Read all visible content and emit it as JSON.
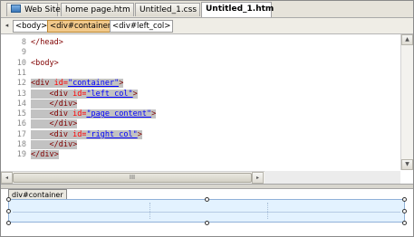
{
  "tabs": [
    {
      "label": "Web Site",
      "icon": "web-site-icon",
      "active": false
    },
    {
      "label": "home page.htm",
      "active": false
    },
    {
      "label": "Untitled_1.css",
      "active": false
    },
    {
      "label": "Untitled_1.htm",
      "active": true
    }
  ],
  "tag_selector": {
    "back_glyph": "◂",
    "forward_glyph": "▸",
    "crumbs": [
      "<body>",
      "<div#container>",
      "<div#left_col>"
    ],
    "selected_index": 1,
    "selected_color": "#f2c98a"
  },
  "code": {
    "lines": [
      {
        "num": "8",
        "parts": [
          {
            "t": "</head>",
            "c": "tag"
          }
        ],
        "indent": "",
        "highlight": false
      },
      {
        "num": "9",
        "parts": [],
        "indent": "",
        "highlight": false
      },
      {
        "num": "10",
        "parts": [
          {
            "t": "<body>",
            "c": "tag"
          }
        ],
        "indent": "",
        "highlight": false
      },
      {
        "num": "11",
        "parts": [],
        "indent": "",
        "highlight": false
      },
      {
        "num": "12",
        "parts": [
          {
            "t": "<div ",
            "c": "tag"
          },
          {
            "t": "id=",
            "c": "attr"
          },
          {
            "t": "\"container\"",
            "c": "val"
          },
          {
            "t": ">",
            "c": "tag"
          }
        ],
        "indent": "",
        "highlight": true
      },
      {
        "num": "13",
        "parts": [
          {
            "t": "<div ",
            "c": "tag"
          },
          {
            "t": "id=",
            "c": "attr"
          },
          {
            "t": "\"left_col\"",
            "c": "val"
          },
          {
            "t": ">",
            "c": "tag"
          }
        ],
        "indent": "    ",
        "highlight": true
      },
      {
        "num": "14",
        "parts": [
          {
            "t": "</div>",
            "c": "tag"
          }
        ],
        "indent": "    ",
        "highlight": true
      },
      {
        "num": "15",
        "parts": [
          {
            "t": "<div ",
            "c": "tag"
          },
          {
            "t": "id=",
            "c": "attr"
          },
          {
            "t": "\"page_content\"",
            "c": "val"
          },
          {
            "t": ">",
            "c": "tag"
          }
        ],
        "indent": "    ",
        "highlight": true
      },
      {
        "num": "16",
        "parts": [
          {
            "t": "</div>",
            "c": "tag"
          }
        ],
        "indent": "    ",
        "highlight": true
      },
      {
        "num": "17",
        "parts": [
          {
            "t": "<div ",
            "c": "tag"
          },
          {
            "t": "id=",
            "c": "attr"
          },
          {
            "t": "\"right_col\"",
            "c": "val"
          },
          {
            "t": ">",
            "c": "tag"
          }
        ],
        "indent": "    ",
        "highlight": true
      },
      {
        "num": "18",
        "parts": [
          {
            "t": "</div>",
            "c": "tag"
          }
        ],
        "indent": "    ",
        "highlight": true
      },
      {
        "num": "19",
        "parts": [
          {
            "t": "</div>",
            "c": "tag"
          }
        ],
        "indent": "",
        "highlight": true
      }
    ],
    "highlight_color": "#c2c2c2"
  },
  "scroll": {
    "up_glyph": "▲",
    "down_glyph": "▼",
    "left_glyph": "◂",
    "right_glyph": "▸",
    "thumb_grip": "III"
  },
  "design_view": {
    "selected_element_label": "div#container",
    "box_color": "#e3f2ff"
  }
}
